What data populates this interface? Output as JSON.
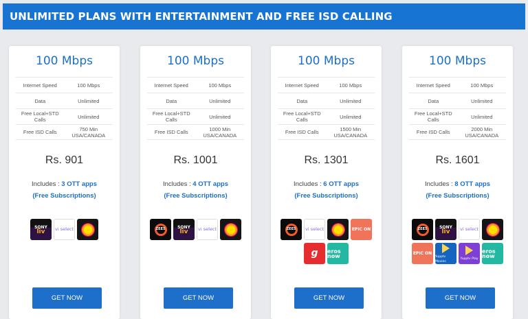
{
  "banner": {
    "title": "UNLIMITED PLANS WITH ENTERTAINMENT AND FREE ISD CALLING"
  },
  "colors": {
    "brand_blue": "#1874d2",
    "card_bg": "#ffffff",
    "page_bg": "#e9eaee"
  },
  "plans": [
    {
      "title": "100 Mbps",
      "specs": [
        {
          "k": "Internet Speed",
          "v": "100 Mbps"
        },
        {
          "k": "Data",
          "v": "Unlimited"
        },
        {
          "k": "Free Local+STD Calls",
          "v": "Unlimited"
        },
        {
          "k": "Free ISD Calls",
          "v": "750 Min USA/CANADA"
        }
      ],
      "price": "Rs. 901",
      "includes_prefix": "Includes : ",
      "ott": "3 OTT apps",
      "subs": "(Free Subscriptions)",
      "logos": [
        "sony-liv",
        "vodafone-select",
        "sun-nxt"
      ],
      "cta": "GET NOW"
    },
    {
      "title": "100 Mbps",
      "specs": [
        {
          "k": "Internet Speed",
          "v": "100 Mbps"
        },
        {
          "k": "Data",
          "v": "Unlimited"
        },
        {
          "k": "Free Local+STD Calls",
          "v": "Unlimited"
        },
        {
          "k": "Free ISD Calls",
          "v": "1000 Min USA/CANADA"
        }
      ],
      "price": "Rs. 1001",
      "includes_prefix": "Includes : ",
      "ott": "4 OTT apps",
      "subs": "(Free Subscriptions)",
      "logos": [
        "zee5",
        "sony-liv",
        "vodafone-select",
        "sun-nxt"
      ],
      "cta": "GET NOW"
    },
    {
      "title": "100 Mbps",
      "specs": [
        {
          "k": "Internet Speed",
          "v": "100 Mbps"
        },
        {
          "k": "Data",
          "v": "Unlimited"
        },
        {
          "k": "Free Local+STD Calls",
          "v": "Unlimited"
        },
        {
          "k": "Free ISD Calls",
          "v": "1500 Min USA/CANADA"
        }
      ],
      "price": "Rs. 1301",
      "includes_prefix": "Includes : ",
      "ott": "6 OTT apps",
      "subs": "(Free Subscriptions)",
      "logos": [
        "zee5",
        "vodafone-select",
        "sun-nxt",
        "epic-on",
        "gaana",
        "eros-now"
      ],
      "cta": "GET NOW"
    },
    {
      "title": "100 Mbps",
      "specs": [
        {
          "k": "Internet Speed",
          "v": "100 Mbps"
        },
        {
          "k": "Data",
          "v": "Unlimited"
        },
        {
          "k": "Free Local+STD Calls",
          "v": "Unlimited"
        },
        {
          "k": "Free ISD Calls",
          "v": "2000 Min USA/CANADA"
        }
      ],
      "price": "Rs. 1601",
      "includes_prefix": "Includes : ",
      "ott": "8 OTT apps",
      "subs": "(Free Subscriptions)",
      "logos": [
        "zee5",
        "sony-liv",
        "vodafone-select",
        "sun-nxt",
        "epic-on",
        "yupptv-movies",
        "yupptv-play",
        "eros-now"
      ],
      "cta": "GET NOW"
    }
  ],
  "logo_text": {
    "sony": "SONY",
    "liv": "liv",
    "vodafone": "vi select",
    "zee": "ZEE5",
    "epic": "EPIC ON",
    "gaana": "g",
    "eros": "eros now",
    "yupp_movies": "Yupptv Movies",
    "yupp_play": "Yupptv Play"
  }
}
